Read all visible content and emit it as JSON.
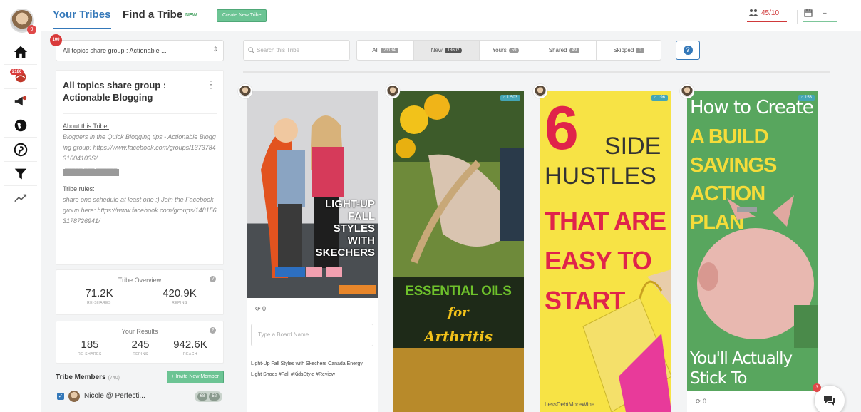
{
  "topbar": {
    "tabs": [
      "Your Tribes",
      "Find a Tribe"
    ],
    "find_new_badge": "NEW",
    "create_button": "Create New Tribe",
    "quota": "45/10"
  },
  "rail": {
    "avatar_badge": "9",
    "items": [
      {
        "icon": "home-icon"
      },
      {
        "icon": "tailwind-logo-icon",
        "badge": "2180"
      },
      {
        "icon": "megaphone-icon"
      },
      {
        "icon": "globe-icon"
      },
      {
        "icon": "pinterest-icon"
      },
      {
        "icon": "filter-icon"
      },
      {
        "icon": "trend-icon"
      }
    ]
  },
  "left": {
    "select_value": "All topics share group : Actionable ...",
    "select_badge": "100",
    "tribe_title": "All topics share group : Actionable Blogging",
    "about_heading": "About this Tribe:",
    "about_text": "Bloggers in the Quick Blogging tips - Actionable Blogging group: https://www.facebook.com/groups/137378431604103S/",
    "about_redacted": "█████ ███ ██████",
    "rules_heading": "Tribe rules:",
    "rules_text": "share one schedule at least one :) Join the Facebook group here: https://www.facebook.com/groups/148156317872694​1/",
    "overview_title": "Tribe Overview",
    "overview_stats": [
      {
        "value": "71.2K",
        "label": "RE-SHARES"
      },
      {
        "value": "420.9K",
        "label": "REPINS"
      }
    ],
    "results_title": "Your Results",
    "results_stats": [
      {
        "value": "185",
        "label": "RE-SHARES"
      },
      {
        "value": "245",
        "label": "REPINS"
      },
      {
        "value": "942.6K",
        "label": "REACH"
      }
    ],
    "members_title": "Tribe Members",
    "members_count": "(740)",
    "invite_button": "+ Invite New Member",
    "member": {
      "name": "Nicole @ Perfecti...",
      "a": "68",
      "b": "52"
    }
  },
  "filters": {
    "search_placeholder": "Search this Tribe",
    "tabs": [
      {
        "label": "All",
        "count": "23134"
      },
      {
        "label": "New",
        "count": "18602"
      },
      {
        "label": "Yours",
        "count": "59"
      },
      {
        "label": "Shared",
        "count": "49"
      },
      {
        "label": "Skipped",
        "count": "0"
      }
    ],
    "active": "New"
  },
  "pins": {
    "pin1": {
      "overlay": [
        "LIGHT-UP",
        "FALL",
        "STYLES",
        "WITH",
        "SKECHERS"
      ],
      "repins": "0",
      "board_placeholder": "Type a Board Name",
      "description": "Light-Up Fall Styles with Skechers Canada Energy Light Shoes #Fall #KidsStyle #Review"
    },
    "pin2": {
      "badge": "1,503",
      "title_line1": "ESSENTIAL OILS",
      "title_line2": "for",
      "title_line3": "Arthritis"
    },
    "pin3": {
      "badge": "196",
      "big_number": "6",
      "side": "SIDE",
      "hustles": "HUSTLES",
      "lines": [
        "THAT ARE",
        "EASY TO",
        "START"
      ],
      "watermark": "LessDebtMoreWine"
    },
    "pin4": {
      "badge": "153",
      "script_top": "How to Create",
      "lines": [
        "A BUILD",
        "SAVINGS",
        "ACTION PLAN"
      ],
      "script_bottom_1": "You'll Actually",
      "script_bottom_2": "Stick To",
      "repins": "0"
    }
  },
  "chat_badge": "3"
}
